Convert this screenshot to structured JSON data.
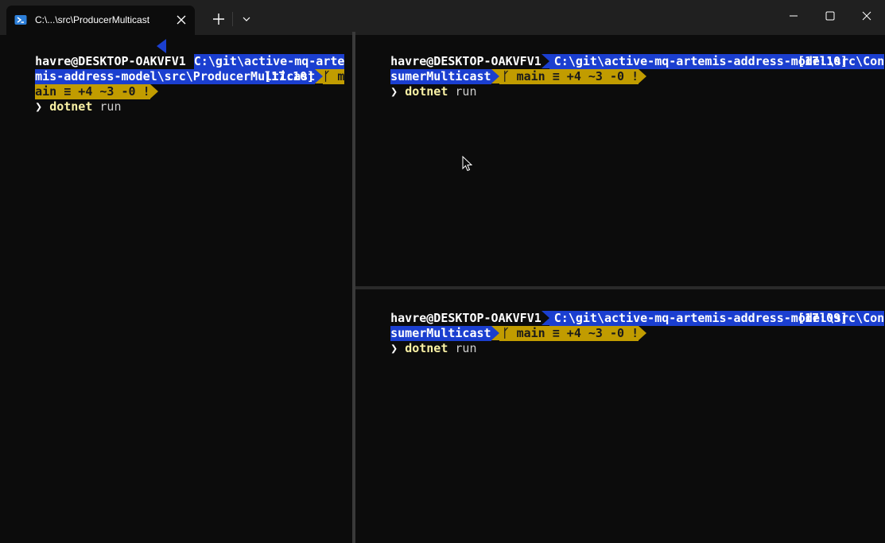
{
  "window": {
    "tab_title": "C:\\...\\src\\ProducerMulticast",
    "icons": {
      "tab": "powershell-icon",
      "close_tab": "close-icon",
      "new_tab": "plus-icon",
      "dropdown": "chevron-down-icon",
      "minimize": "minimize-icon",
      "maximize": "maximize-icon",
      "close_window": "close-icon"
    }
  },
  "colors": {
    "background": "#0c0c0c",
    "path_segment": "#1b3fd0",
    "git_segment": "#c19c00",
    "command": "#f9f1a5"
  },
  "panes": {
    "left": {
      "user": "havre@DESKTOP-OAKVFV1",
      "path_part1": "C:\\git\\active-mq-arte",
      "path_part2": "mis-address-model\\src\\ProducerMulticast",
      "git_part1": "ᚴ m",
      "git_part2": "ain ≡ +4 ~3 -0 !",
      "time": "[17:10]",
      "prompt": "❯",
      "command": "dotnet",
      "argument": "run"
    },
    "right_top": {
      "user": "havre@DESKTOP-OAKVFV1",
      "path_part1": "C:\\git\\active-mq-artemis-address-model\\src\\Con",
      "path_part2": "sumerMulticast",
      "git": "ᚴ main ≡ +4 ~3 -0 !",
      "time": "[17:10]",
      "prompt": "❯",
      "command": "dotnet",
      "argument": "run"
    },
    "right_bottom": {
      "user": "havre@DESKTOP-OAKVFV1",
      "path_part1": "C:\\git\\active-mq-artemis-address-model\\src\\Con",
      "path_part2": "sumerMulticast",
      "git": "ᚴ main ≡ +4 ~3 -0 !",
      "time": "[17:09]",
      "prompt": "❯",
      "command": "dotnet",
      "argument": "run"
    }
  }
}
